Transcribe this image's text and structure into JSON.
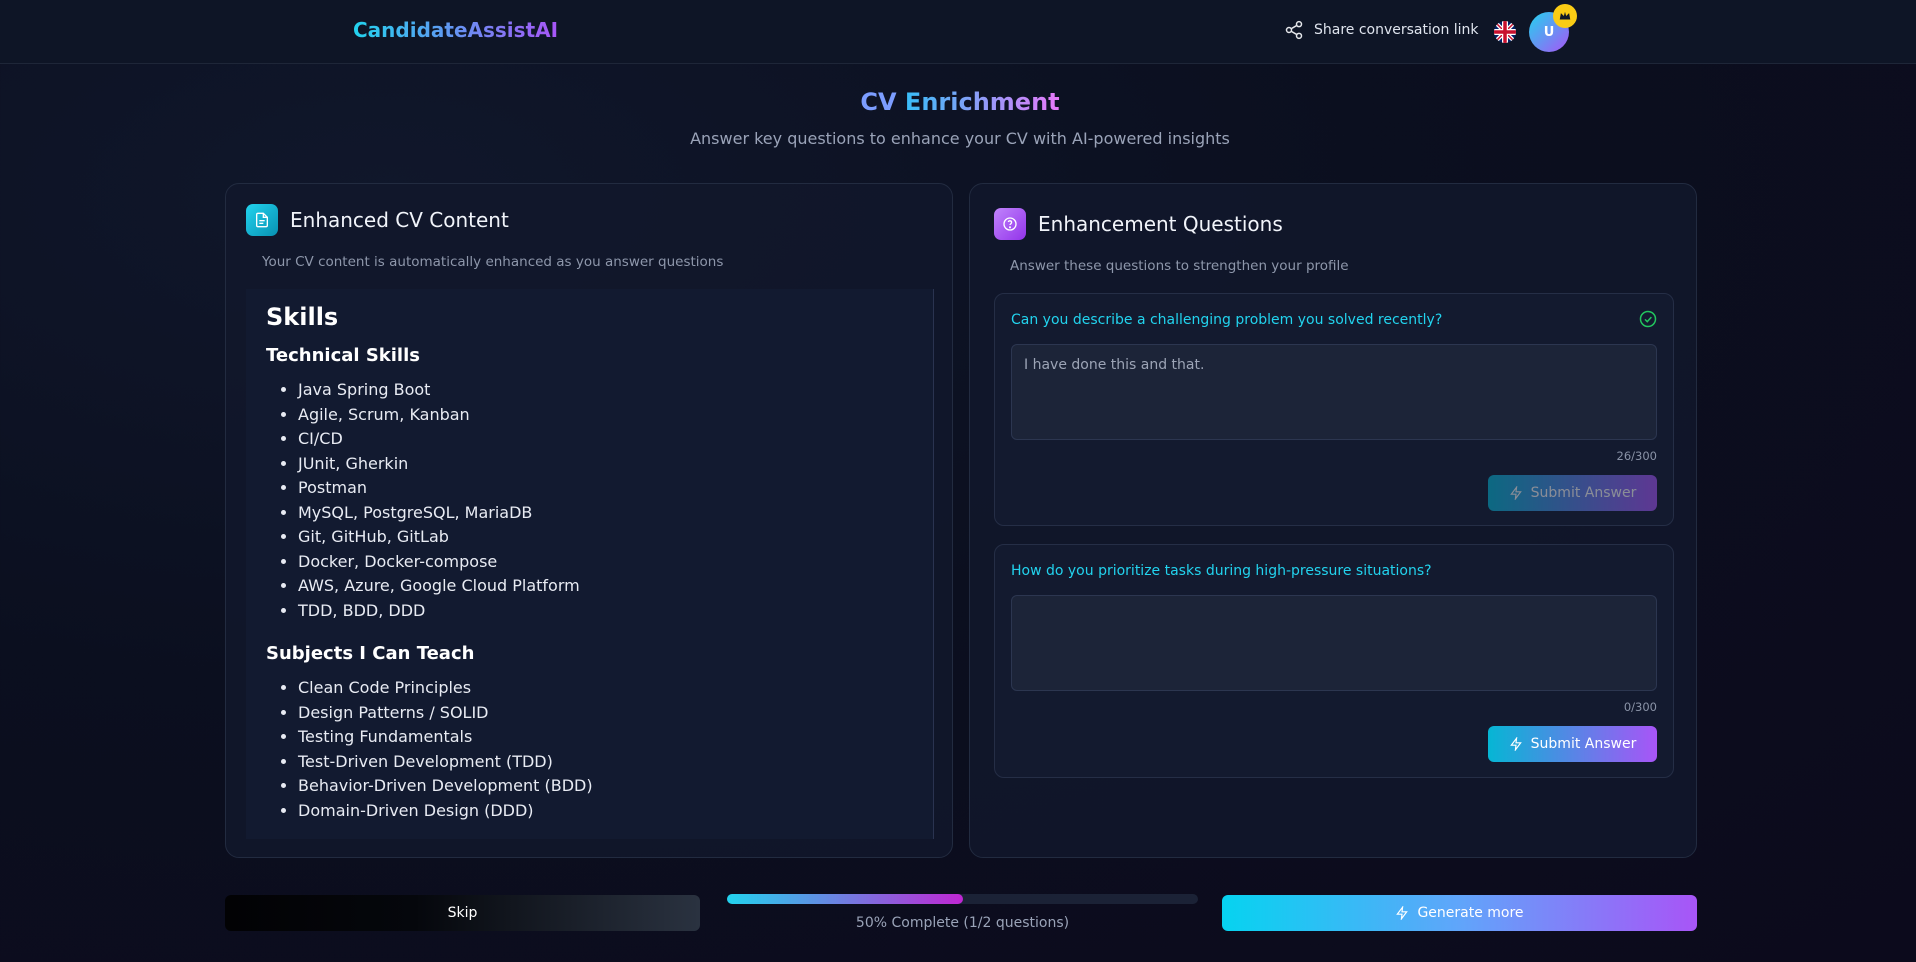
{
  "header": {
    "brand": "CandidateAssistAI",
    "share_label": "Share conversation link",
    "avatar_initial": "U"
  },
  "page": {
    "title_part1": "CV",
    "title_part2": "Enrichment",
    "subtitle": "Answer key questions to enhance your CV with AI-powered insights"
  },
  "cv_panel": {
    "title": "Enhanced CV Content",
    "description": "Your CV content is automatically enhanced as you answer questions",
    "section_title": "Skills",
    "groups": [
      {
        "heading": "Technical Skills",
        "items": [
          "Java Spring Boot",
          "Agile, Scrum, Kanban",
          "CI/CD",
          "JUnit, Gherkin",
          "Postman",
          "MySQL, PostgreSQL, MariaDB",
          "Git, GitHub, GitLab",
          "Docker, Docker-compose",
          "AWS, Azure, Google Cloud Platform",
          "TDD, BDD, DDD"
        ]
      },
      {
        "heading": "Subjects I Can Teach",
        "items": [
          "Clean Code Principles",
          "Design Patterns / SOLID",
          "Testing Fundamentals",
          "Test-Driven Development (TDD)",
          "Behavior-Driven Development (BDD)",
          "Domain-Driven Design (DDD)"
        ]
      }
    ]
  },
  "questions_panel": {
    "title": "Enhancement Questions",
    "description": "Answer these questions to strengthen your profile",
    "questions": [
      {
        "question": "Can you describe a challenging problem you solved recently?",
        "answer": "I have done this and that.",
        "counter": "26/300",
        "submit_label": "Submit Answer",
        "answered": true
      },
      {
        "question": "How do you prioritize tasks during high-pressure situations?",
        "answer": "",
        "counter": "0/300",
        "submit_label": "Submit Answer",
        "answered": false
      }
    ]
  },
  "footer": {
    "skip_label": "Skip",
    "progress": 0.5,
    "progress_text": "50% Complete (1/2 questions)",
    "generate_label": "Generate more"
  },
  "colors": {
    "accent_cyan": "#22d3ee",
    "accent_purple": "#a855f7",
    "check_green": "#22c55e"
  }
}
